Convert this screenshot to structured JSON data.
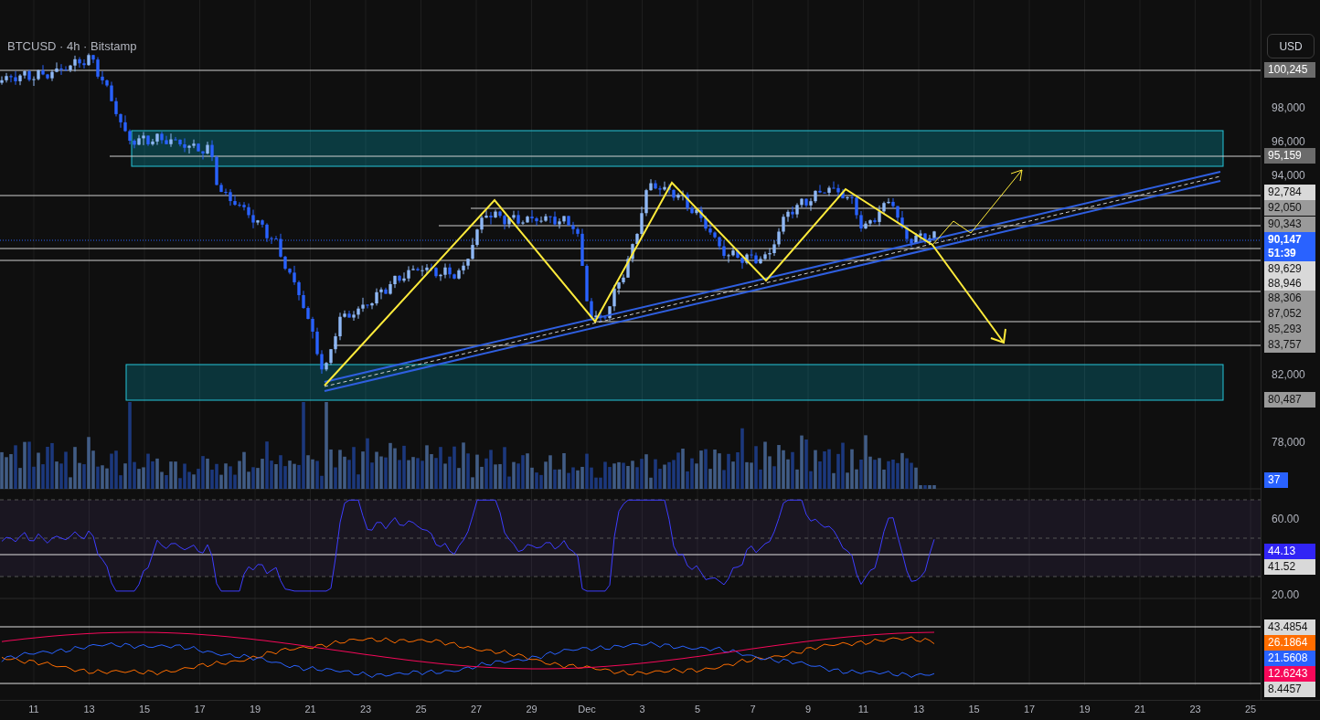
{
  "chart_header": {
    "title": "BTCUSD · 4h · Bitstamp"
  },
  "currency_button": "USD",
  "price_axis": {
    "ticks": [
      "98,000",
      "96,000",
      "94,000",
      "82,000",
      "78,000"
    ],
    "labels": [
      {
        "text": "100,245",
        "kind": "dark"
      },
      {
        "text": "95,159",
        "kind": "dark"
      },
      {
        "text": "92,784",
        "kind": "light"
      },
      {
        "text": "92,050",
        "kind": "gray"
      },
      {
        "text": "90,343",
        "kind": "gray"
      },
      {
        "text": "90,147",
        "countdown": "51:39",
        "kind": "current"
      },
      {
        "text": "89,629",
        "kind": "light"
      },
      {
        "text": "88,946",
        "kind": "light"
      },
      {
        "text": "88,306",
        "kind": "gray"
      },
      {
        "text": "87,052",
        "kind": "gray"
      },
      {
        "text": "85,293",
        "kind": "gray"
      },
      {
        "text": "83,757",
        "kind": "gray"
      },
      {
        "text": "80,487",
        "kind": "gray"
      }
    ]
  },
  "volume_label": "37",
  "rsi_axis": {
    "ticks": [
      "60.00",
      "20.00"
    ],
    "labels": [
      {
        "text": "44.13",
        "color": "#3124f5"
      },
      {
        "text": "41.52",
        "color": "#d9d9d9"
      }
    ]
  },
  "dmi_axis": {
    "labels": [
      {
        "text": "43.4854",
        "color": "#d9d9d9"
      },
      {
        "text": "26.1864",
        "color": "#ff6d00"
      },
      {
        "text": "21.5608",
        "color": "#2962ff"
      },
      {
        "text": "12.6243",
        "color": "#f7085a"
      },
      {
        "text": "8.4457",
        "color": "#d9d9d9"
      }
    ]
  },
  "time_axis": [
    "11",
    "13",
    "15",
    "17",
    "19",
    "21",
    "23",
    "25",
    "27",
    "29",
    "Dec",
    "3",
    "5",
    "7",
    "9",
    "11",
    "13",
    "15",
    "17",
    "19",
    "21",
    "23",
    "25"
  ]
}
